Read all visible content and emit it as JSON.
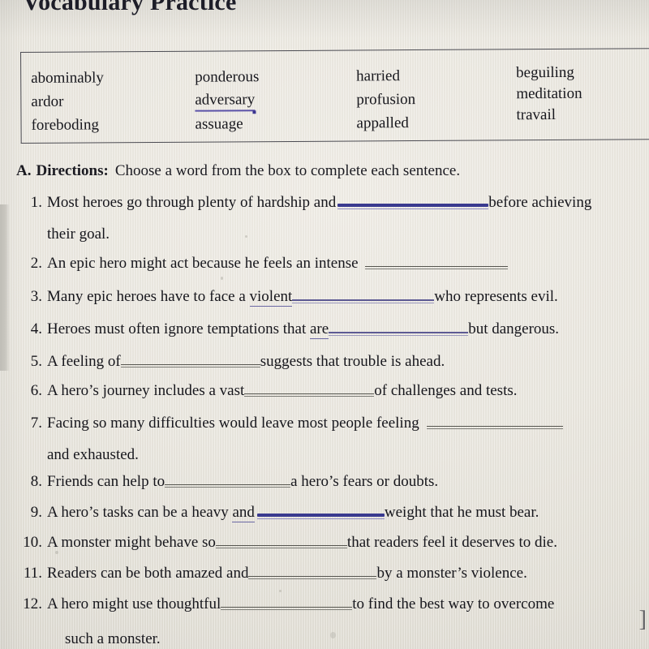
{
  "title": "Vocabulary Practice",
  "word_bank": {
    "columns": [
      {
        "words": [
          "abominably",
          "ardor",
          "foreboding"
        ]
      },
      {
        "words": [
          "ponderous",
          "adversary",
          "assuage"
        ],
        "misspelled_index": 1
      },
      {
        "words": [
          "harried",
          "profusion",
          "appalled"
        ]
      },
      {
        "words": [
          "beguiling",
          "meditation",
          "travail"
        ]
      }
    ]
  },
  "directions": {
    "section": "A.",
    "label": "Directions:",
    "text": "Choose a word from the box to complete each sentence."
  },
  "questions": [
    {
      "number": "1.",
      "before": "Most heroes go through plenty of hardship and",
      "blank_style": "blueheavy",
      "after": "before achieving",
      "continuation": "their goal."
    },
    {
      "number": "2.",
      "before": "An epic hero might act because he feels an intense",
      "blank_style": "grey",
      "after": ""
    },
    {
      "number": "3.",
      "before": "Many epic heroes have to face a violent",
      "before_spellcheck": "violent",
      "blank_style": "blue",
      "after": "who represents evil."
    },
    {
      "number": "4.",
      "before": "Heroes must often ignore temptations that are",
      "before_spellcheck": "are",
      "blank_style": "blue",
      "after": "but dangerous."
    },
    {
      "number": "5.",
      "before": "A feeling of",
      "blank_style": "grey",
      "after": "suggests that trouble is ahead."
    },
    {
      "number": "6.",
      "before": "A hero’s journey includes a vast",
      "blank_style": "grey",
      "after": "of challenges and tests."
    },
    {
      "number": "7.",
      "before": "Facing so many difficulties would leave most people feeling",
      "blank_style": "grey",
      "after": "",
      "continuation": "and exhausted."
    },
    {
      "number": "8.",
      "before": "Friends can help to",
      "blank_style": "grey",
      "after": "a hero’s fears or doubts."
    },
    {
      "number": "9.",
      "before": "A hero’s tasks can be a heavy and",
      "before_spellcheck": "and",
      "blank_style": "blueheavy",
      "after": "weight that he must bear."
    },
    {
      "number": "10.",
      "before": "A monster might behave so",
      "blank_style": "grey",
      "after": "that readers feel it deserves to die."
    },
    {
      "number": "11.",
      "before": "Readers can be both amazed and",
      "blank_style": "grey",
      "after": "by a monster’s violence."
    },
    {
      "number": "12.",
      "before": "A hero might use thoughtful",
      "blank_style": "grey",
      "after": "to find the best way to overcome",
      "continuation": "such a monster."
    }
  ],
  "artifacts": {
    "edge_bracket": "]"
  },
  "colors": {
    "paper": "#e9e6de",
    "ink": "#16161c",
    "rule_grey": "#55554f",
    "rule_blue": "#5d5a93",
    "rule_blue_heavy": "#3a3a8f",
    "spellcheck_underline": "#5b52a8",
    "box_border": "#4b4b52"
  }
}
